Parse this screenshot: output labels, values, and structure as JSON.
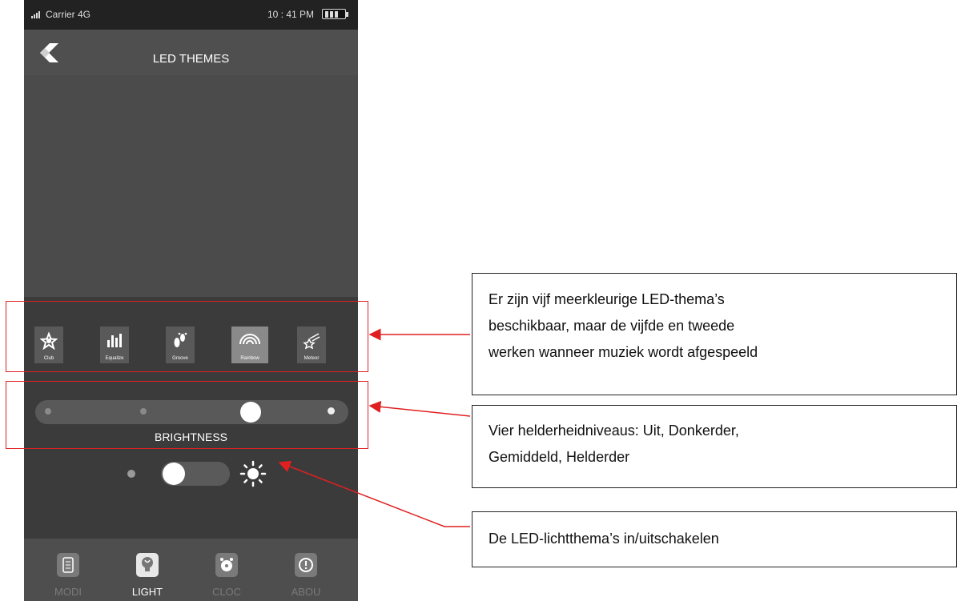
{
  "status_bar": {
    "carrier": "Carrier 4G",
    "time": "10 : 41 PM"
  },
  "header": {
    "title": "LED THEMES",
    "back_icon": "back-arrow-icon"
  },
  "themes": [
    {
      "label": "Club",
      "icon": "club-star-icon"
    },
    {
      "label": "Equalize",
      "icon": "equalizer-icon"
    },
    {
      "label": "Groove",
      "icon": "footprint-icon"
    },
    {
      "label": "Rainbow",
      "icon": "rainbow-icon",
      "selected": true
    },
    {
      "label": "Meteor",
      "icon": "meteor-star-icon"
    }
  ],
  "brightness": {
    "label": "BRIGHTNESS",
    "levels": 4,
    "selected_level": 3
  },
  "light_toggle": {
    "on": false,
    "icon_off": "dim-dot-icon",
    "icon_on": "sun-icon"
  },
  "tabs": [
    {
      "label": "MODI",
      "icon": "modi-icon"
    },
    {
      "label": "LIGHT",
      "icon": "bulb-icon",
      "active": true
    },
    {
      "label": "CLOC",
      "icon": "alarm-clock-icon"
    },
    {
      "label": "ABOU",
      "icon": "info-icon"
    }
  ],
  "annotations": {
    "themes_text": [
      "Er zijn vijf meerkleurige LED-thema’s",
      "beschikbaar, maar de vijfde en tweede",
      "werken wanneer muziek wordt afgespeeld"
    ],
    "brightness_text": [
      "Vier helderheidniveaus: Uit, Donkerder,",
      "Gemiddeld, Helderder"
    ],
    "toggle_text": [
      "De LED-lichtthema’s in/uitschakelen"
    ],
    "colors": {
      "highlight": "#e02020",
      "callout_border": "#222222"
    }
  }
}
